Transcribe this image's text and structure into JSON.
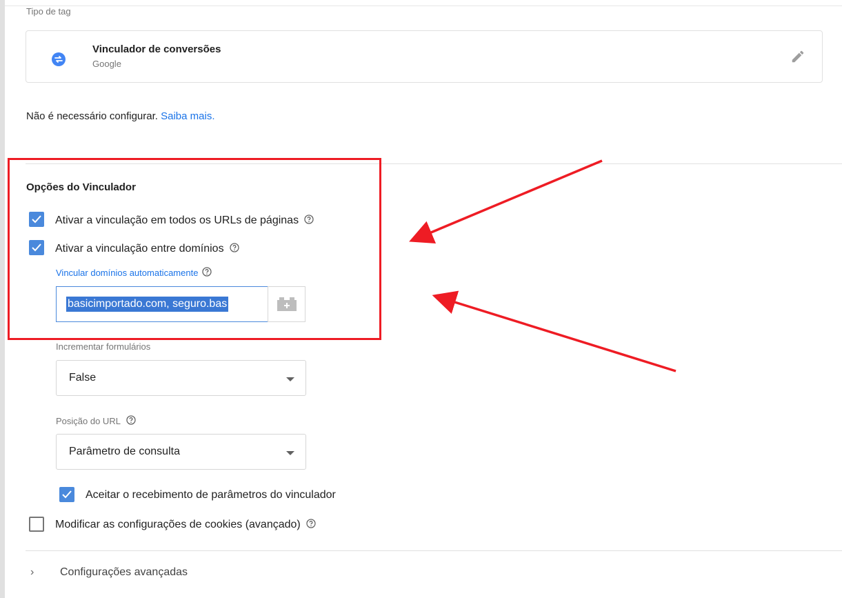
{
  "tag_type": {
    "label": "Tipo de tag",
    "name": "Vinculador de conversões",
    "vendor": "Google",
    "icon": "conversion-linker-icon"
  },
  "no_config": {
    "text": "Não é necessário configurar.",
    "link": "Saiba mais."
  },
  "linker_options": {
    "title": "Opções do Vinculador",
    "options": [
      {
        "label": "Ativar a vinculação em todos os URLs de páginas",
        "checked": true
      },
      {
        "label": "Ativar a vinculação entre domínios",
        "checked": true
      }
    ],
    "auto_link_domains": {
      "label": "Vincular domínios automaticamente",
      "value": "basicimportado.com, seguro.bas"
    },
    "decorate_forms": {
      "label": "Incrementar formulários",
      "value": "False"
    },
    "url_position": {
      "label": "Posição do URL",
      "value": "Parâmetro de consulta"
    },
    "accept_incoming": {
      "label": "Aceitar o recebimento de parâmetros do vinculador",
      "checked": true
    },
    "override_cookies": {
      "label": "Modificar as configurações de cookies (avançado)",
      "checked": false
    }
  },
  "advanced": {
    "label": "Configurações avançadas"
  },
  "colors": {
    "accent": "#4a89dc",
    "link": "#1a73e8",
    "annotation": "#ee1c24"
  }
}
